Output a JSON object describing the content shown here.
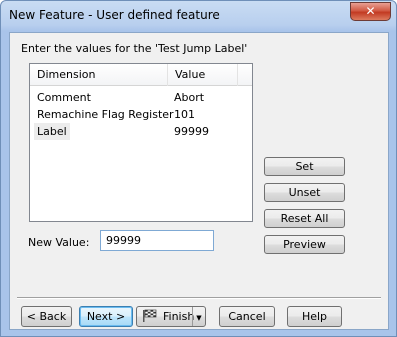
{
  "window": {
    "title": "New Feature - User defined feature",
    "close_glyph": "✕"
  },
  "instruction": "Enter the values for the 'Test Jump Label'",
  "table": {
    "columns": [
      "Dimension",
      "Value"
    ],
    "rows": [
      {
        "dimension": "Comment",
        "value": "Abort"
      },
      {
        "dimension": "Remachine Flag Register",
        "value": "101"
      },
      {
        "dimension": "Label",
        "value": "99999"
      }
    ],
    "selected_row": 2
  },
  "new_value": {
    "label": "New Value:",
    "value": "99999"
  },
  "side_buttons": {
    "set": "Set",
    "unset": "Unset",
    "reset_all": "Reset All",
    "preview": "Preview"
  },
  "bottom_buttons": {
    "back": "< Back",
    "next": "Next >",
    "finish": "Finish",
    "cancel": "Cancel",
    "help": "Help"
  },
  "icons": {
    "close": "close-icon",
    "finish": "finish-flag-icon",
    "dropdown": "chevron-down-icon"
  }
}
